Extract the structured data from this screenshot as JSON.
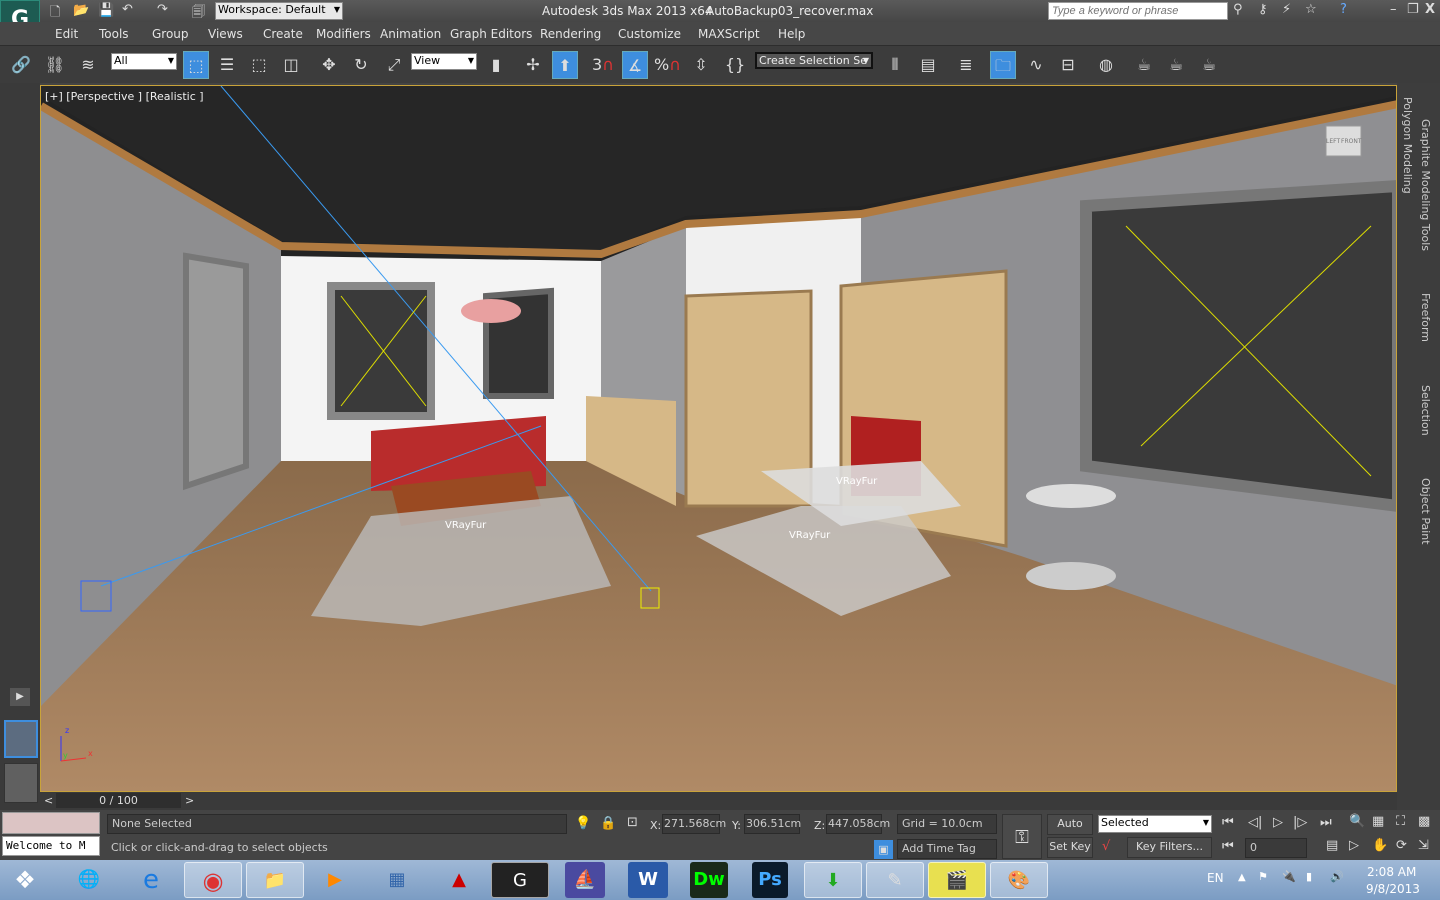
{
  "title": {
    "app": "Autodesk 3ds Max  2013 x64",
    "file": "AutoBackup03_recover.max",
    "workspace": "Workspace: Default",
    "search_placeholder": "Type a keyword or phrase"
  },
  "menu": [
    "Edit",
    "Tools",
    "Group",
    "Views",
    "Create",
    "Modifiers",
    "Animation",
    "Graph Editors",
    "Rendering",
    "Customize",
    "MAXScript",
    "Help"
  ],
  "toolbar": {
    "selection_filter": "All",
    "ref_coord": "View",
    "named_selection": "Create Selection Se",
    "snap_label": "3",
    "percent_label": "%"
  },
  "viewport": {
    "label": "[+] [Perspective ] [Realistic ]",
    "fur_labels": [
      "VRayFur",
      "VRayFur",
      "VRayFur"
    ],
    "viewcube_labels": [
      "LEFT",
      "FRONT"
    ],
    "axis": [
      "x",
      "y",
      "z"
    ]
  },
  "ribbon": {
    "tabs": [
      "Graphite Modeling Tools",
      "Freeform",
      "Selection",
      "Object Paint"
    ],
    "panel": "Polygon Modeling"
  },
  "timeslider": {
    "frame": "0 / 100",
    "prev": "<",
    "next": ">"
  },
  "status": {
    "maxscript": "Welcome to M",
    "selection": "None Selected",
    "prompt": "Click or click-and-drag to select objects",
    "x_label": "X:",
    "x": "271.568cm",
    "y_label": "Y:",
    "y": "306.51cm",
    "z_label": "Z:",
    "z": "447.058cm",
    "grid": "Grid = 10.0cm",
    "add_time_tag": "Add Time Tag",
    "auto_key": "Auto Key",
    "set_key": "Set Key",
    "key_mode": "Selected",
    "key_filters": "Key Filters...",
    "current_frame": "0"
  },
  "taskbar": {
    "lang": "EN",
    "time": "2:08 AM",
    "date": "9/8/2013",
    "apps": [
      {
        "name": "start",
        "glyph": "❖"
      },
      {
        "name": "network",
        "glyph": "🌐"
      },
      {
        "name": "internet-explorer",
        "glyph": "e"
      },
      {
        "name": "chrome",
        "glyph": "◉"
      },
      {
        "name": "explorer",
        "glyph": "📁"
      },
      {
        "name": "media-player",
        "glyph": "▶"
      },
      {
        "name": "calculator",
        "glyph": "▦"
      },
      {
        "name": "autocad",
        "glyph": "▲"
      },
      {
        "name": "3ds-max",
        "glyph": "G"
      },
      {
        "name": "app-ship",
        "glyph": "⛵"
      },
      {
        "name": "word",
        "glyph": "W"
      },
      {
        "name": "dreamweaver",
        "glyph": "Dw"
      },
      {
        "name": "photoshop",
        "glyph": "Ps"
      },
      {
        "name": "download-manager",
        "glyph": "⬇"
      },
      {
        "name": "notepad",
        "glyph": "✎"
      },
      {
        "name": "media-classic",
        "glyph": "🎬"
      },
      {
        "name": "paint",
        "glyph": "🎨"
      }
    ]
  },
  "colors": {
    "accent": "#3e8ede",
    "viewport_border": "#c9a33a",
    "taskbar": "#8aa8cc"
  }
}
